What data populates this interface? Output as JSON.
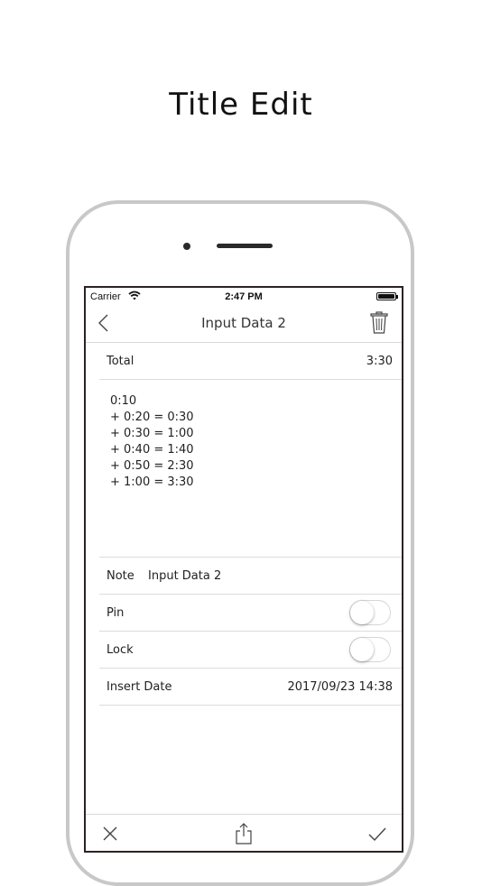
{
  "promo": {
    "title": "Title Edit"
  },
  "status_bar": {
    "carrier": "Carrier",
    "time": "2:47 PM"
  },
  "nav": {
    "title": "Input Data 2"
  },
  "total": {
    "label": "Total",
    "value": "3:30"
  },
  "calculation": {
    "lines": [
      "0:10",
      "+ 0:20 = 0:30",
      "+ 0:30 = 1:00",
      "+ 0:40 = 1:40",
      "+ 0:50 = 2:30",
      "+ 1:00 = 3:30"
    ]
  },
  "note": {
    "label": "Note",
    "value": "Input Data 2"
  },
  "pin": {
    "label": "Pin",
    "on": false
  },
  "lock": {
    "label": "Lock",
    "on": false
  },
  "insert_date": {
    "label": "Insert Date",
    "value": "2017/09/23 14:38"
  },
  "icons": {
    "back": "chevron-left-icon",
    "trash": "trash-icon",
    "close": "close-icon",
    "share": "share-icon",
    "done": "checkmark-icon",
    "wifi": "wifi-icon",
    "battery": "battery-icon"
  },
  "colors": {
    "screen_border": "#2b2221",
    "phone_frame": "#c8c8c8",
    "divider": "#dcdcdc"
  }
}
